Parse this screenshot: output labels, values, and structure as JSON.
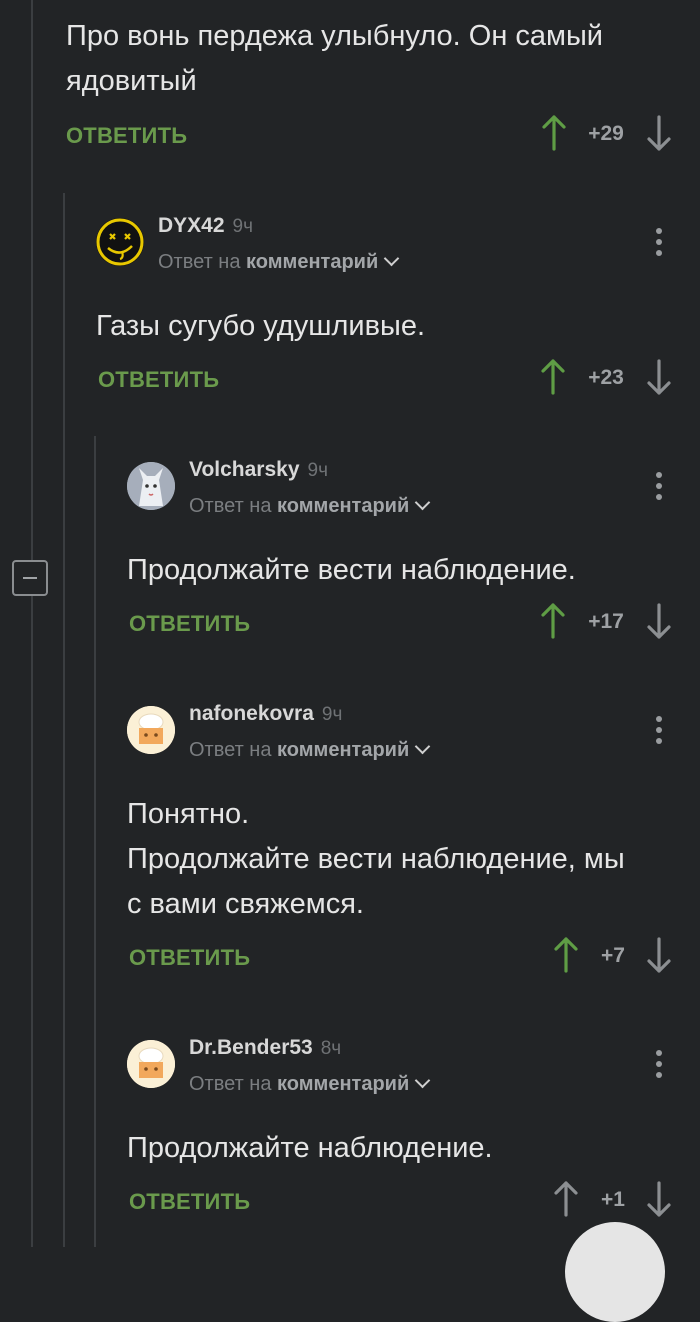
{
  "top_comment": {
    "text": "Про вонь пердежа улыбнуло. Он самый\nядовитый",
    "reply_label": "ОТВЕТИТЬ",
    "rating": "+29"
  },
  "comments": [
    {
      "username": "DYX42",
      "time": "9ч",
      "reply_prefix": "Ответ на",
      "reply_target": "комментарий",
      "text": "Газы сугубо удушливые.",
      "reply_label": "ОТВЕТИТЬ",
      "rating": "+23",
      "avatar_icon": "smiley-avatar-icon"
    },
    {
      "username": "Volcharsky",
      "time": "9ч",
      "reply_prefix": "Ответ на",
      "reply_target": "комментарий",
      "text": "Продолжайте вести наблюдение.",
      "reply_label": "ОТВЕТИТЬ",
      "rating": "+17",
      "avatar_icon": "wolf-avatar-icon"
    },
    {
      "username": "nafonekovra",
      "time": "9ч",
      "reply_prefix": "Ответ на",
      "reply_target": "комментарий",
      "text": "Понятно.\nПродолжайте вести наблюдение, мы\nс вами свяжемся.",
      "reply_label": "ОТВЕТИТЬ",
      "rating": "+7",
      "avatar_icon": "chef-avatar-icon"
    },
    {
      "username": "Dr.Bender53",
      "time": "8ч",
      "reply_prefix": "Ответ на",
      "reply_target": "комментарий",
      "text": "Продолжайте наблюдение.",
      "reply_label": "ОТВЕТИТЬ",
      "rating": "+1",
      "avatar_icon": "chef-avatar-icon"
    }
  ],
  "colors": {
    "background": "#222426",
    "reply_green": "#6a9a4c",
    "upvote_active": "#5f9d45",
    "upvote_neutral": "#8c8f92"
  }
}
